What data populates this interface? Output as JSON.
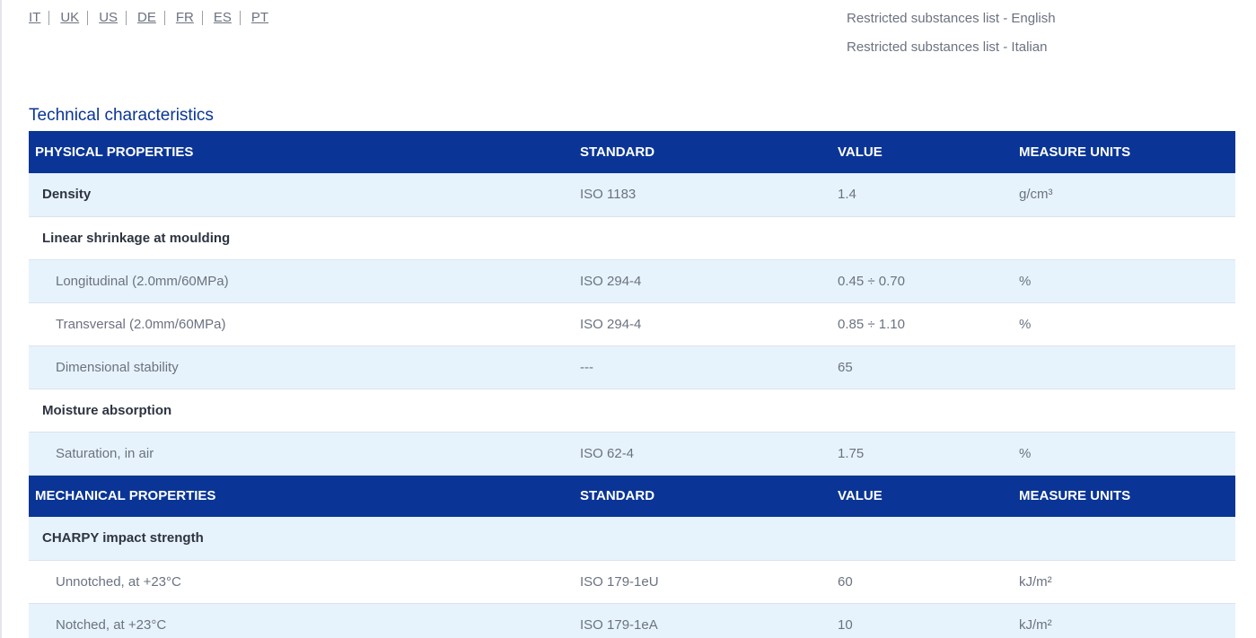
{
  "languages": [
    "IT",
    "UK",
    "US",
    "DE",
    "FR",
    "ES",
    "PT"
  ],
  "documents": {
    "english": "Restricted substances list - English",
    "italian": "Restricted substances list - Italian"
  },
  "section_title": "Technical characteristics",
  "physical": {
    "header": {
      "property": "PHYSICAL PROPERTIES",
      "standard": "STANDARD",
      "value": "VALUE",
      "units": "MEASURE UNITS"
    },
    "rows": [
      {
        "label": "Density",
        "standard": "ISO 1183",
        "value": "1.4",
        "units": "g/cm³"
      },
      {
        "label": "Linear shrinkage at moulding",
        "standard": "",
        "value": "",
        "units": ""
      },
      {
        "label": "Longitudinal (2.0mm/60MPa)",
        "standard": "ISO 294-4",
        "value": "0.45 ÷ 0.70",
        "units": "%"
      },
      {
        "label": "Transversal (2.0mm/60MPa)",
        "standard": "ISO 294-4",
        "value": "0.85 ÷ 1.10",
        "units": "%"
      },
      {
        "label": "Dimensional stability",
        "standard": "---",
        "value": "65",
        "units": ""
      },
      {
        "label": "Moisture absorption",
        "standard": "",
        "value": "",
        "units": ""
      },
      {
        "label": "Saturation, in air",
        "standard": "ISO 62-4",
        "value": "1.75",
        "units": "%"
      }
    ]
  },
  "mechanical": {
    "header": {
      "property": "MECHANICAL PROPERTIES",
      "standard": "STANDARD",
      "value": "VALUE",
      "units": "MEASURE UNITS"
    },
    "rows": [
      {
        "label": "CHARPY impact strength",
        "standard": "",
        "value": "",
        "units": ""
      },
      {
        "label": "Unnotched, at +23°C",
        "standard": "ISO 179-1eU",
        "value": "60",
        "units": "kJ/m²"
      },
      {
        "label": "Notched, at +23°C",
        "standard": "ISO 179-1eA",
        "value": "10",
        "units": "kJ/m²"
      }
    ]
  },
  "colors": {
    "header_bg": "#0a3596",
    "title": "#0a3596",
    "row_alt": "#e7f3fc"
  }
}
